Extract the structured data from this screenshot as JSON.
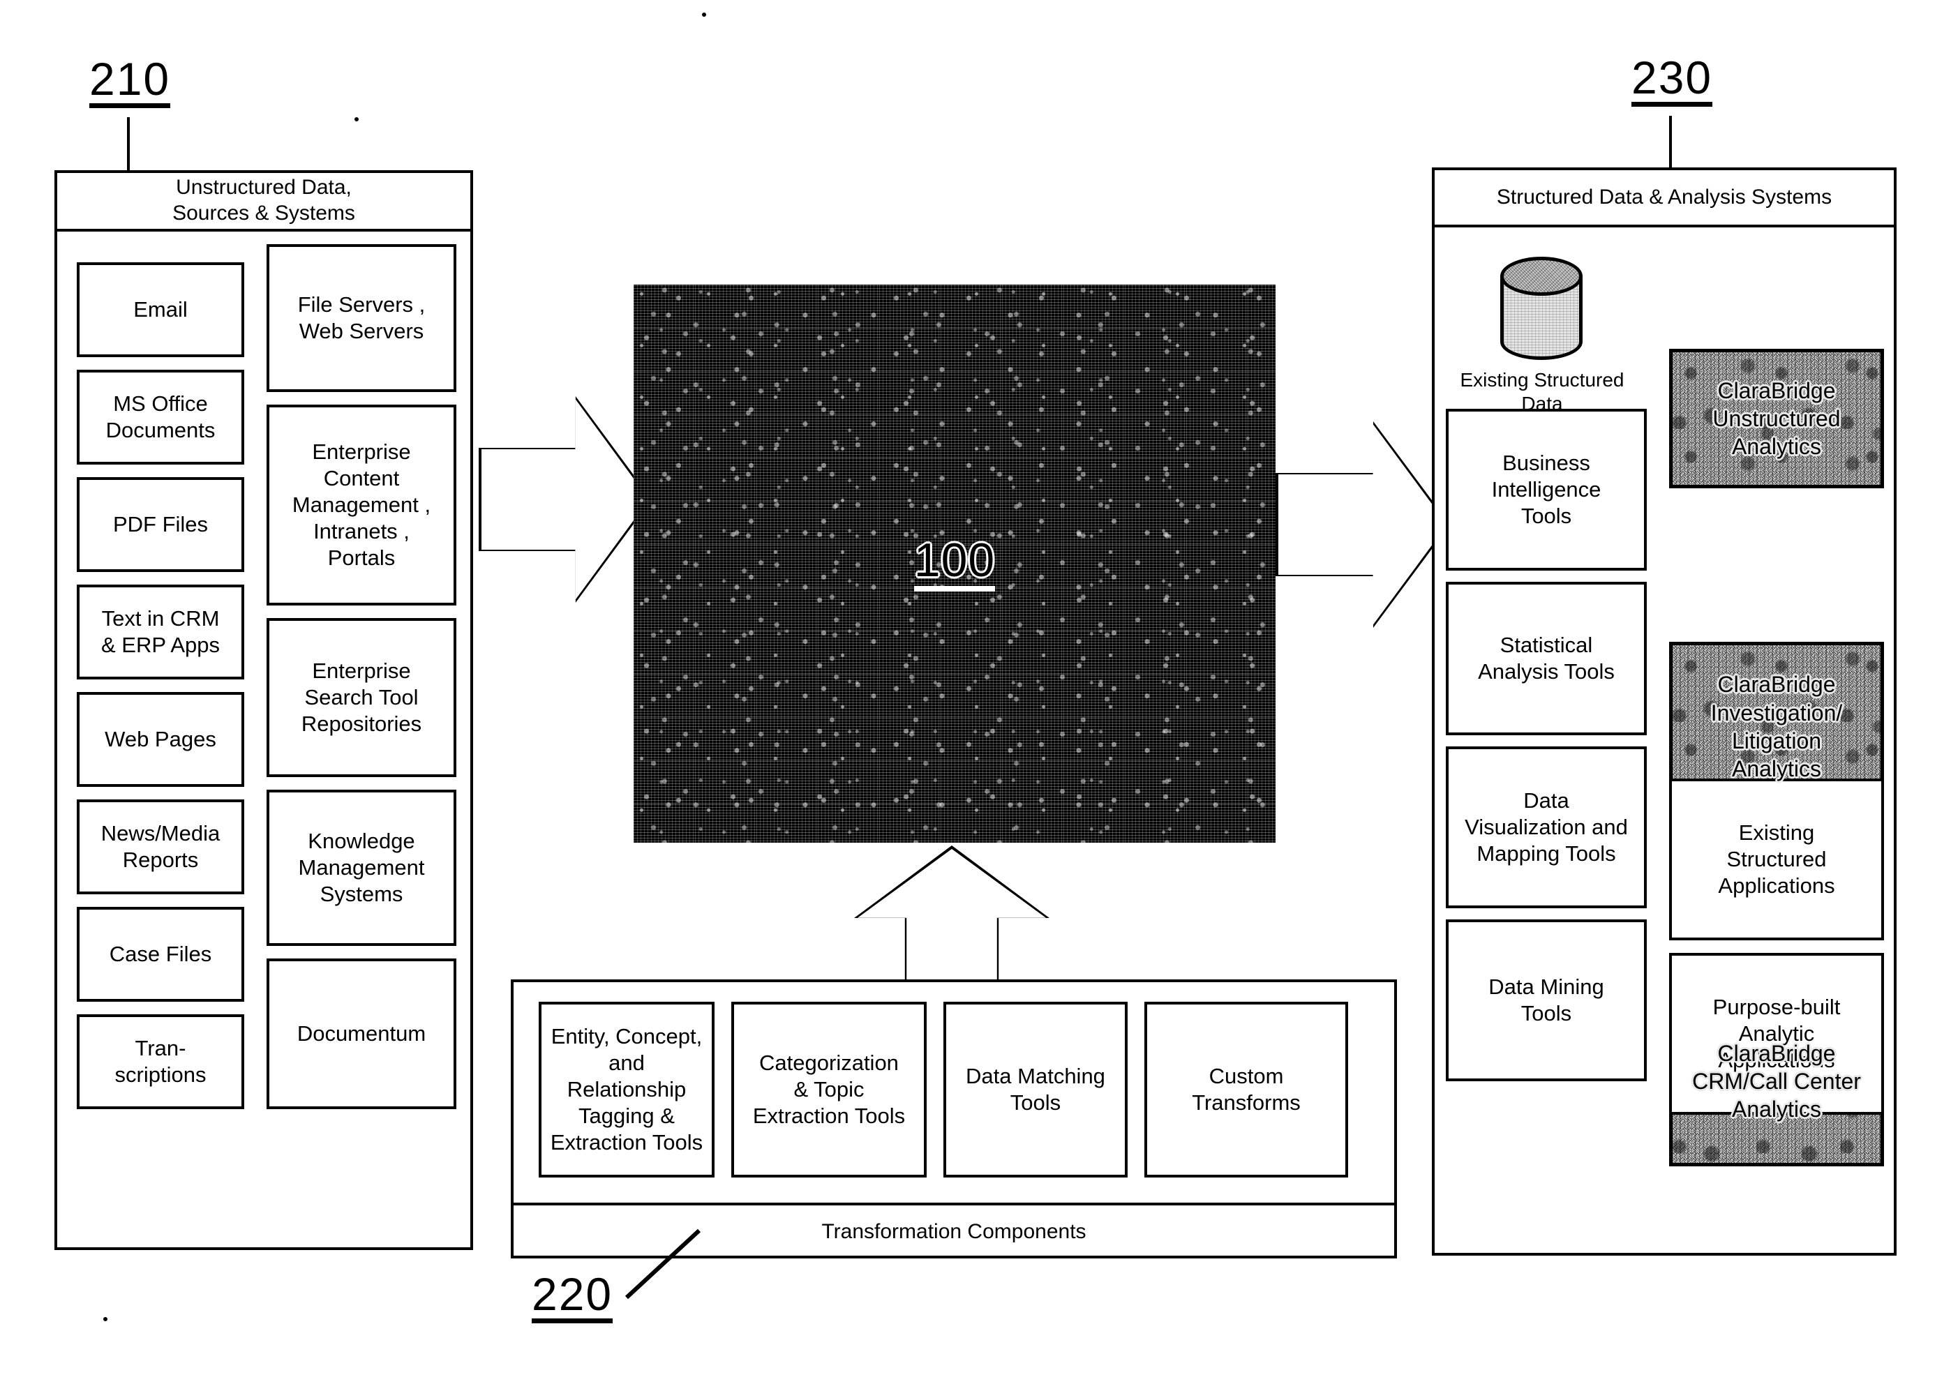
{
  "figure": {
    "refs": {
      "sources": "210",
      "transformation": "220",
      "analysis": "230",
      "core": "100"
    }
  },
  "sources_panel": {
    "ref": "210",
    "title": "Unstructured Data,\nSources & Systems",
    "title_line1": "Unstructured Data,",
    "title_line2": "Sources & Systems",
    "column1": [
      {
        "label": "Email"
      },
      {
        "label": "MS Office\nDocuments"
      },
      {
        "label": "PDF Files"
      },
      {
        "label": "Text in CRM\n& ERP Apps"
      },
      {
        "label": "Web Pages"
      },
      {
        "label": "News/Media\nReports"
      },
      {
        "label": "Case Files"
      },
      {
        "label": "Tran-\nscriptions"
      }
    ],
    "column2": [
      {
        "label": "File Servers ,\nWeb Servers"
      },
      {
        "label": "Enterprise\nContent\nManagement ,\nIntranets ,\nPortals"
      },
      {
        "label": "Enterprise\nSearch Tool\nRepositories"
      },
      {
        "label": "Knowledge\nManagement\nSystems"
      },
      {
        "label": "Documentum"
      }
    ]
  },
  "core": {
    "ref": "100",
    "label": "100"
  },
  "transformation_panel": {
    "ref": "220",
    "footer_label": "Transformation Components",
    "components": [
      {
        "label": "Entity, Concept,\nand\nRelationship\nTagging &\nExtraction Tools"
      },
      {
        "label": "Categorization\n& Topic\nExtraction Tools"
      },
      {
        "label": "Data Matching\nTools"
      },
      {
        "label": "Custom\nTransforms"
      }
    ]
  },
  "analysis_panel": {
    "ref": "230",
    "title": "Structured Data & Analysis Systems",
    "datastore": {
      "icon": "database-cylinder-icon",
      "caption": "Existing Structured Data"
    },
    "column1": [
      {
        "label": "Business\nIntelligence\nTools"
      },
      {
        "label": "Statistical\nAnalysis Tools"
      },
      {
        "label": "Data\nVisualization and\nMapping Tools"
      },
      {
        "label": "Data Mining\nTools"
      }
    ],
    "column2": [
      {
        "label": "ClaraBridge\nUnstructured\nAnalytics",
        "style": "noisy"
      },
      {
        "label": "ClaraBridge\nInvestigation/\nLitigation\nAnalytics",
        "style": "noisy"
      },
      {
        "label": "ClaraBridge\nCRM/Call Center\nAnalytics",
        "style": "noisy"
      },
      {
        "label": "Existing\nStructured\nApplications",
        "style": "plain"
      },
      {
        "label": "Purpose-built\nAnalytic\nApplications",
        "style": "plain"
      }
    ]
  },
  "colors": {
    "ink": "#000000",
    "paper": "#ffffff",
    "core_fill": "#000000",
    "noise_fill": "#d2d2d2"
  }
}
